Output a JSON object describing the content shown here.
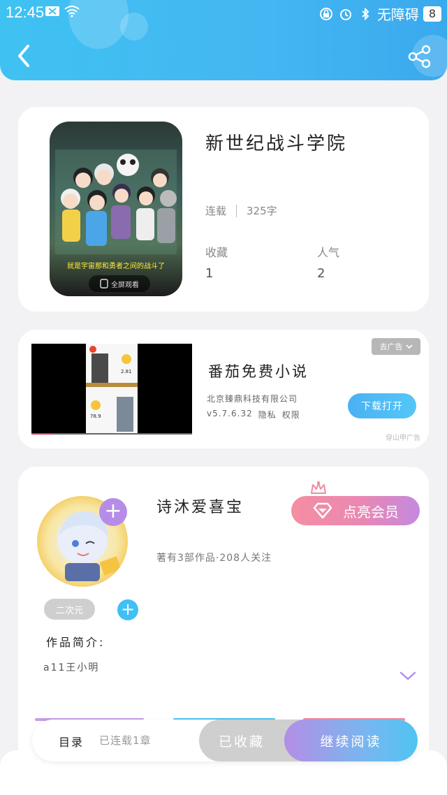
{
  "status_bar": {
    "time": "12:45",
    "accessibility": "无障碍",
    "battery": "8"
  },
  "book": {
    "title": "新世纪战斗学院",
    "serial_status": "连载",
    "word_count": "325字",
    "collect_label": "收藏",
    "collect_value": "1",
    "popularity_label": "人气",
    "popularity_value": "2",
    "cover_caption": "就是宇宙那和勇者之间的战斗了",
    "cover_fullscreen": "全屏观看"
  },
  "ad": {
    "dismiss_label": "去广告",
    "app_name": "番茄免费小说",
    "company": "北京臻鼎科技有限公司",
    "version": "v5.7.6.32",
    "privacy": "隐私",
    "permissions": "权限",
    "download_label": "下载打开",
    "source": "穿山甲广告",
    "video_numbers": [
      "2.81",
      "78.9"
    ]
  },
  "author": {
    "name": "诗沐爱喜宝",
    "vip_label": "点亮会员",
    "stats": "著有3部作品·208人关注",
    "tag": "二次元",
    "intro_label": "作品简介:",
    "intro_text": "a11王小明"
  },
  "bottom_bar": {
    "toc_label": "目录",
    "toc_status": "已连载1章",
    "collected_label": "已收藏",
    "continue_label": "继续阅读"
  },
  "colors": {
    "header_start": "#3fc2f2",
    "header_end": "#3aa9ee",
    "accent_blue": "#40c0f3",
    "accent_purple": "#b58de8",
    "vip_pink": "#f58ea2"
  },
  "icons": [
    "back-arrow-icon",
    "share-icon",
    "plus-icon",
    "crown-icon",
    "diamond-icon",
    "chevron-down-icon"
  ]
}
